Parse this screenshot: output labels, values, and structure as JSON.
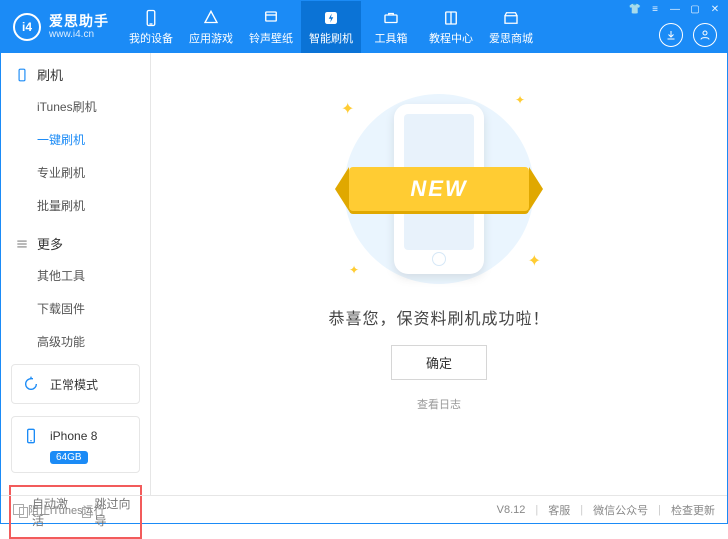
{
  "brand": {
    "logo_text": "i4",
    "title": "爱思助手",
    "subtitle": "www.i4.cn"
  },
  "nav": [
    {
      "label": "我的设备",
      "icon": "device"
    },
    {
      "label": "应用游戏",
      "icon": "apps"
    },
    {
      "label": "铃声壁纸",
      "icon": "music"
    },
    {
      "label": "智能刷机",
      "icon": "flash",
      "active": true
    },
    {
      "label": "工具箱",
      "icon": "toolbox"
    },
    {
      "label": "教程中心",
      "icon": "book"
    },
    {
      "label": "爱思商城",
      "icon": "store"
    }
  ],
  "sidebar": {
    "s1": {
      "title": "刷机",
      "items": [
        "iTunes刷机",
        "一键刷机",
        "专业刷机",
        "批量刷机"
      ],
      "active_index": 1
    },
    "s2": {
      "title": "更多",
      "items": [
        "其他工具",
        "下载固件",
        "高级功能"
      ]
    },
    "mode": {
      "label": "正常模式"
    },
    "device": {
      "name": "iPhone 8",
      "storage": "64GB"
    },
    "checks": {
      "auto_activate": "自动激活",
      "skip_wizard": "跳过向导"
    }
  },
  "main": {
    "ribbon": "NEW",
    "message": "恭喜您，保资料刷机成功啦！",
    "ok": "确定",
    "view_log": "查看日志"
  },
  "status": {
    "block_itunes": "阻止iTunes运行",
    "version": "V8.12",
    "support": "客服",
    "wechat": "微信公众号",
    "check_update": "检查更新"
  }
}
